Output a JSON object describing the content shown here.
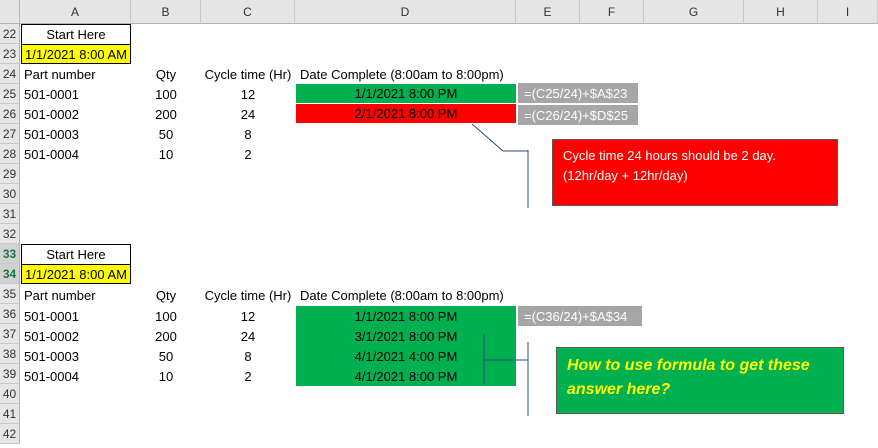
{
  "columns": [
    "A",
    "B",
    "C",
    "D",
    "E",
    "F",
    "G",
    "H",
    "I"
  ],
  "rows": [
    "22",
    "23",
    "24",
    "25",
    "26",
    "27",
    "28",
    "29",
    "30",
    "31",
    "32",
    "33",
    "34",
    "35",
    "36",
    "37",
    "38",
    "39",
    "40",
    "41",
    "42"
  ],
  "block1": {
    "start_here": "Start Here",
    "start_date": "1/1/2021 8:00 AM",
    "headers": {
      "part": "Part number",
      "qty": "Qty",
      "cycle": "Cycle time (Hr)",
      "date": "Date Complete (8:00am to 8:00pm)"
    },
    "data": [
      {
        "part": "501-0001",
        "qty": "100",
        "cycle": "12",
        "date": "1/1/2021 8:00 PM"
      },
      {
        "part": "501-0002",
        "qty": "200",
        "cycle": "24",
        "date": "2/1/2021 8:00 PM"
      },
      {
        "part": "501-0003",
        "qty": "50",
        "cycle": "8"
      },
      {
        "part": "501-0004",
        "qty": "10",
        "cycle": "2"
      }
    ],
    "formula1": "=(C25/24)+$A$23",
    "formula2": "=(C26/24)+$D$25",
    "note_line1": "Cycle time 24 hours should be 2 day.",
    "note_line2": "(12hr/day + 12hr/day)"
  },
  "block2": {
    "start_here": "Start Here",
    "start_date": "1/1/2021 8:00 AM",
    "headers": {
      "part": "Part number",
      "qty": "Qty",
      "cycle": "Cycle time (Hr)",
      "date": "Date Complete (8:00am to 8:00pm)"
    },
    "data": [
      {
        "part": "501-0001",
        "qty": "100",
        "cycle": "12",
        "date": "1/1/2021 8:00 PM"
      },
      {
        "part": "501-0002",
        "qty": "200",
        "cycle": "24",
        "date": "3/1/2021 8:00 PM"
      },
      {
        "part": "501-0003",
        "qty": "50",
        "cycle": "8",
        "date": "4/1/2021 4:00 PM"
      },
      {
        "part": "501-0004",
        "qty": "10",
        "cycle": "2",
        "date": "4/1/2021 8:00 PM"
      }
    ],
    "formula1": "=(C36/24)+$A$34",
    "question": "How to use formula to get these answer here?"
  },
  "colors": {
    "green": "#00b050",
    "red": "#ff0000",
    "yellow": "#ffff00",
    "formula_bg": "#a6a6a6"
  }
}
